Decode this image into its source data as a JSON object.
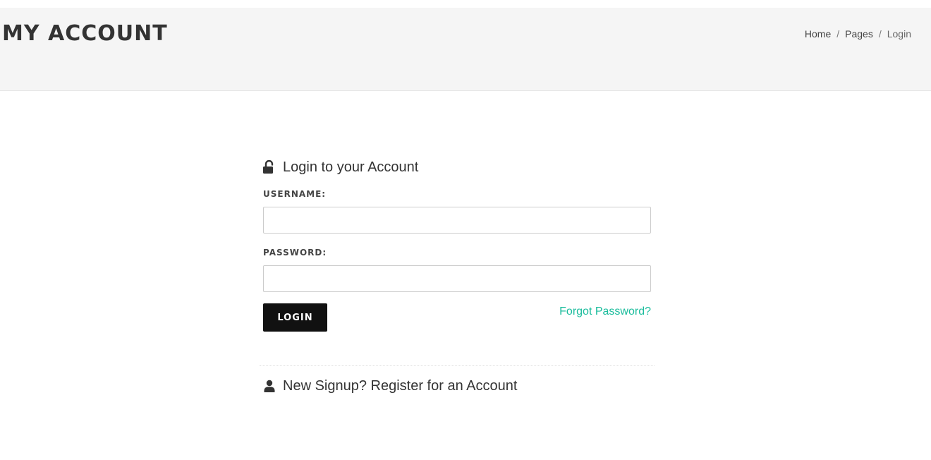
{
  "header": {
    "title": "MY ACCOUNT",
    "breadcrumb": [
      {
        "label": "Home"
      },
      {
        "label": "Pages"
      },
      {
        "label": "Login"
      }
    ],
    "separator": "/"
  },
  "login": {
    "heading": "Login to your Account",
    "heading_icon": "unlock-icon",
    "username_label": "USERNAME:",
    "username_value": "",
    "password_label": "PASSWORD:",
    "password_value": "",
    "login_button": "LOGIN",
    "forgot_link": "Forgot Password?"
  },
  "signup": {
    "heading": "New Signup? Register for an Account",
    "heading_icon": "user-icon"
  },
  "colors": {
    "header_bg": "#f5f5f5",
    "button_bg": "#111111",
    "link": "#1abc9c",
    "text": "#333333"
  }
}
